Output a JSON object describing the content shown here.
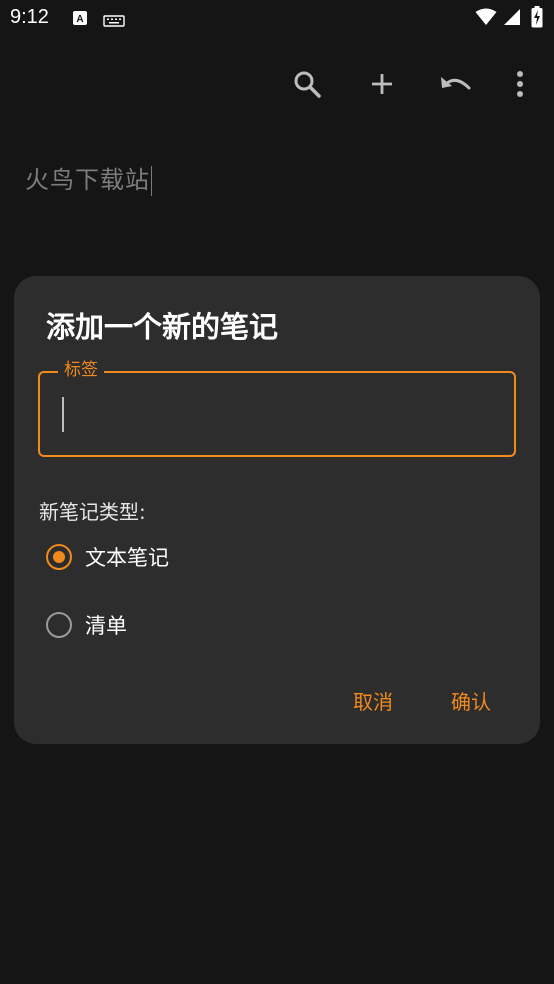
{
  "status_bar": {
    "time": "9:12",
    "icons": [
      "text-input-icon",
      "keyboard-icon",
      "wifi-icon",
      "signal-icon",
      "battery-charging-icon"
    ]
  },
  "toolbar": {
    "icons": [
      "search-icon",
      "add-icon",
      "undo-icon",
      "more-vert-icon"
    ]
  },
  "note": {
    "title": "火鸟下载站"
  },
  "dialog": {
    "title": "添加一个新的笔记",
    "field_label": "标签",
    "field_value": "",
    "type_label": "新笔记类型:",
    "options": [
      {
        "label": "文本笔记",
        "checked": true
      },
      {
        "label": "清单",
        "checked": false
      }
    ],
    "cancel": "取消",
    "confirm": "确认"
  },
  "colors": {
    "accent": "#f08a1c",
    "background": "#151515",
    "dialog": "#2d2d2d"
  }
}
